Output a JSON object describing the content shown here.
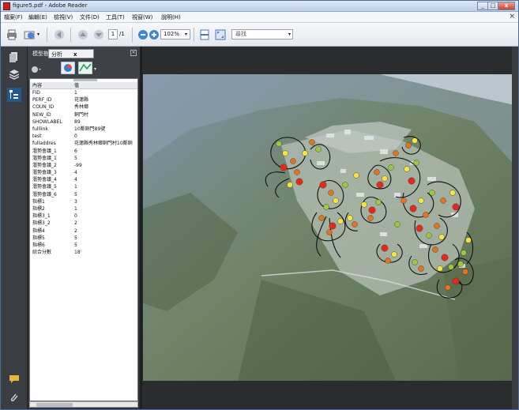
{
  "window": {
    "title": "figure5.pdf - Adobe Reader",
    "buttons": [
      "_",
      "□",
      "x"
    ]
  },
  "menu": {
    "items": [
      "檔案(F)",
      "編輯(E)",
      "檢視(V)",
      "文件(D)",
      "工具(T)",
      "視窗(W)",
      "說明(H)"
    ],
    "close": "×"
  },
  "toolbar": {
    "page_current": "1",
    "page_total": "/1",
    "zoom": "102%",
    "sign_placeholder": "尋找"
  },
  "panel": {
    "tabs": [
      "模型樹",
      "分析"
    ],
    "tab_close": "x",
    "attributes": {
      "headers": [
        "內容",
        "值"
      ],
      "rows": [
        [
          "FID",
          "1"
        ],
        [
          "PERF_ID",
          "花蓮縣"
        ],
        [
          "COUN_ID",
          "秀林鄉"
        ],
        [
          "NEW_ID",
          "銅門村"
        ],
        [
          "SHOWLABEL",
          "89"
        ],
        [
          "fulllink",
          "10鄰銅門89號"
        ],
        [
          "test",
          "0"
        ],
        [
          "fulladdres",
          "花蓮縣秀林鄉銅門村10鄰銅"
        ],
        [
          "潛勢會議_1",
          "6"
        ],
        [
          "潛勢會議_1",
          "5"
        ],
        [
          "潛勢會議_2",
          "-99"
        ],
        [
          "潛勢會議_3",
          "4"
        ],
        [
          "潛勢會議_4",
          "4"
        ],
        [
          "潛勢會議_5",
          "1"
        ],
        [
          "潛勢會議_6",
          "5"
        ],
        [
          "指標1",
          "3"
        ],
        [
          "指標2",
          "1"
        ],
        [
          "指標3_1",
          "0"
        ],
        [
          "指標3_2",
          "2"
        ],
        [
          "指標4",
          "2"
        ],
        [
          "指標5",
          "5"
        ],
        [
          "指標6",
          "5"
        ],
        [
          "綜合分數",
          "18"
        ]
      ]
    }
  },
  "colors": {
    "accent": "#2b6cc4",
    "panel_bg": "#2f3237",
    "viewer_bg": "#2b2c2e",
    "point_red": "#e22b1d",
    "point_orange": "#e9731c",
    "point_yellow": "#f3e53a",
    "point_green": "#9ac93b"
  },
  "icons": [
    "print-icon",
    "email-icon",
    "back-icon",
    "prev-page-icon",
    "next-page-icon",
    "zoom-out-icon",
    "zoom-in-icon",
    "fit-page-icon",
    "full-screen-icon",
    "pages-icon",
    "layers-icon",
    "model-tree-icon",
    "comment-icon",
    "attachment-icon"
  ]
}
